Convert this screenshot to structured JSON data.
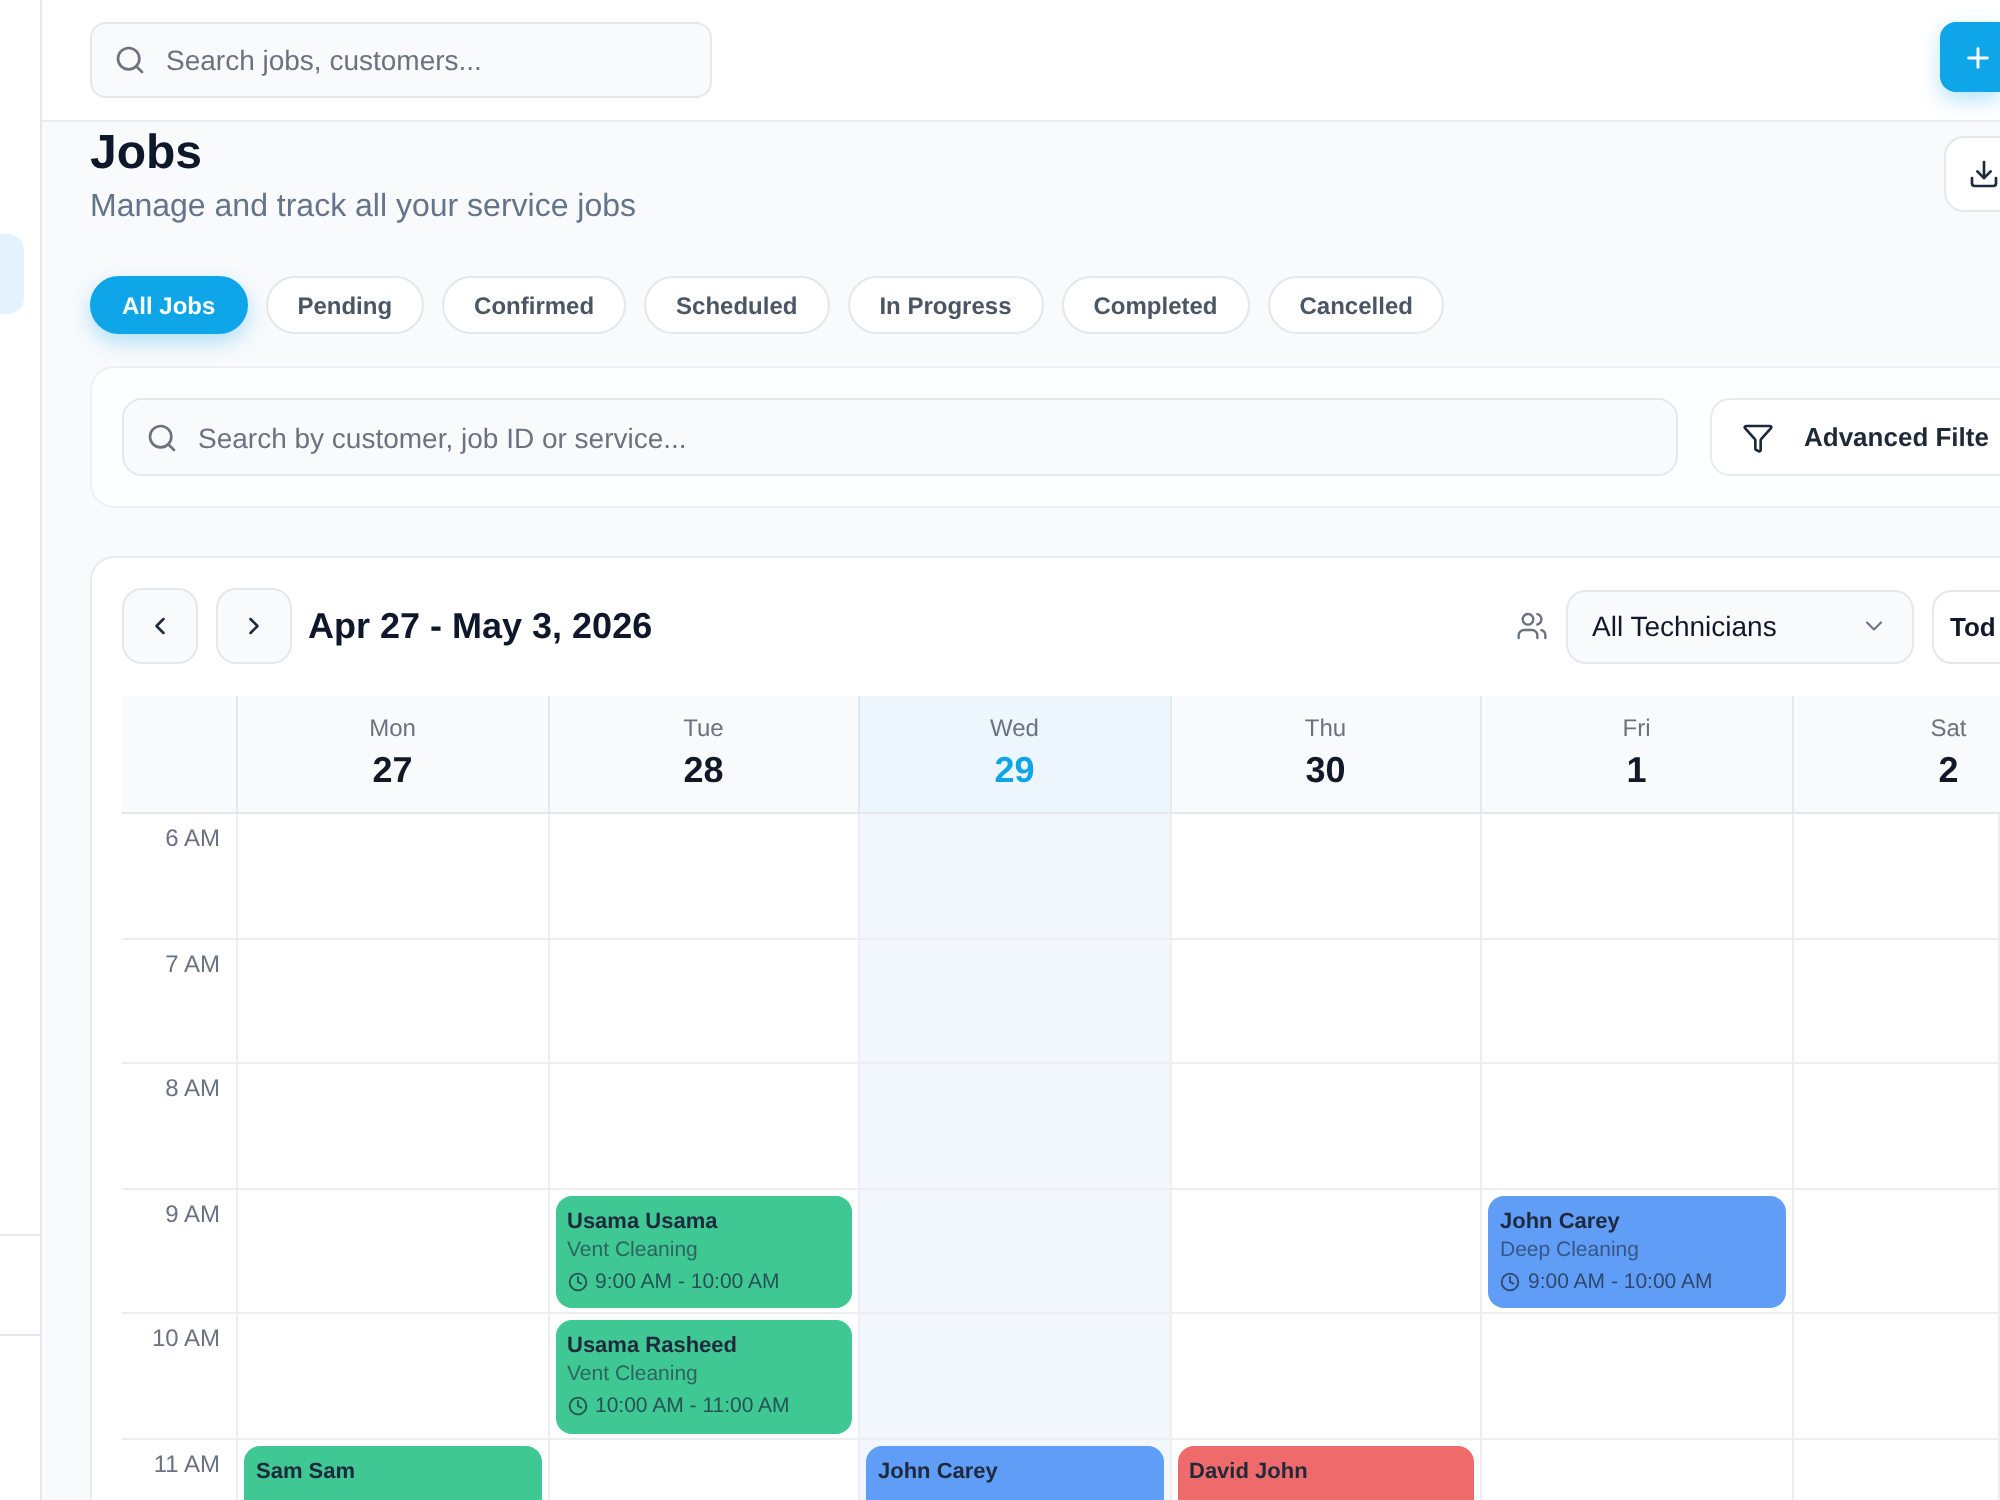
{
  "sidebar": {
    "items": [
      {
        "selected": true
      }
    ]
  },
  "header": {
    "search": {
      "placeholder": "Search jobs, customers..."
    }
  },
  "page": {
    "title": "Jobs",
    "subtitle": "Manage and track all your service jobs"
  },
  "tabs": [
    {
      "label": "All Jobs",
      "selected": true
    },
    {
      "label": "Pending",
      "selected": false
    },
    {
      "label": "Confirmed",
      "selected": false
    },
    {
      "label": "Scheduled",
      "selected": false
    },
    {
      "label": "In Progress",
      "selected": false
    },
    {
      "label": "Completed",
      "selected": false
    },
    {
      "label": "Cancelled",
      "selected": false
    }
  ],
  "filters": {
    "search": {
      "placeholder": "Search by customer, job ID or service..."
    },
    "advanced_button": {
      "label": "Advanced Filte"
    }
  },
  "calendar": {
    "range": "Apr 27 - May 3, 2026",
    "technician_select": {
      "value": "All Technicians"
    },
    "today_button": {
      "label": "Tod"
    },
    "days": [
      {
        "weekday": "Mon",
        "date": "27",
        "today": false
      },
      {
        "weekday": "Tue",
        "date": "28",
        "today": false
      },
      {
        "weekday": "Wed",
        "date": "29",
        "today": true
      },
      {
        "weekday": "Thu",
        "date": "30",
        "today": false
      },
      {
        "weekday": "Fri",
        "date": "1",
        "today": false
      },
      {
        "weekday": "Sat",
        "date": "2",
        "today": false
      }
    ],
    "rows": [
      {
        "time": "6 AM"
      },
      {
        "time": "7 AM"
      },
      {
        "time": "8 AM"
      },
      {
        "time": "9 AM",
        "cells": [
          null,
          {
            "customer": "Usama Usama",
            "service": "Vent Cleaning",
            "time": "9:00 AM - 10:00 AM",
            "color": "#3fc794"
          },
          null,
          null,
          {
            "customer": "John Carey",
            "service": "Deep Cleaning",
            "time": "9:00 AM - 10:00 AM",
            "color": "#609df7"
          },
          null
        ]
      },
      {
        "time": "10 AM",
        "cells": [
          null,
          {
            "customer": "Usama Rasheed",
            "service": "Vent Cleaning",
            "time": "10:00 AM - 11:00 AM",
            "color": "#3fc794"
          },
          null,
          null,
          null,
          null
        ]
      },
      {
        "time": "11 AM",
        "cells": [
          {
            "customer": "Sam Sam",
            "color": "#3fc794"
          },
          null,
          {
            "customer": "John Carey",
            "color": "#609df7"
          },
          {
            "customer": "David John",
            "color": "#ef6b6b"
          },
          null,
          null
        ]
      }
    ]
  }
}
